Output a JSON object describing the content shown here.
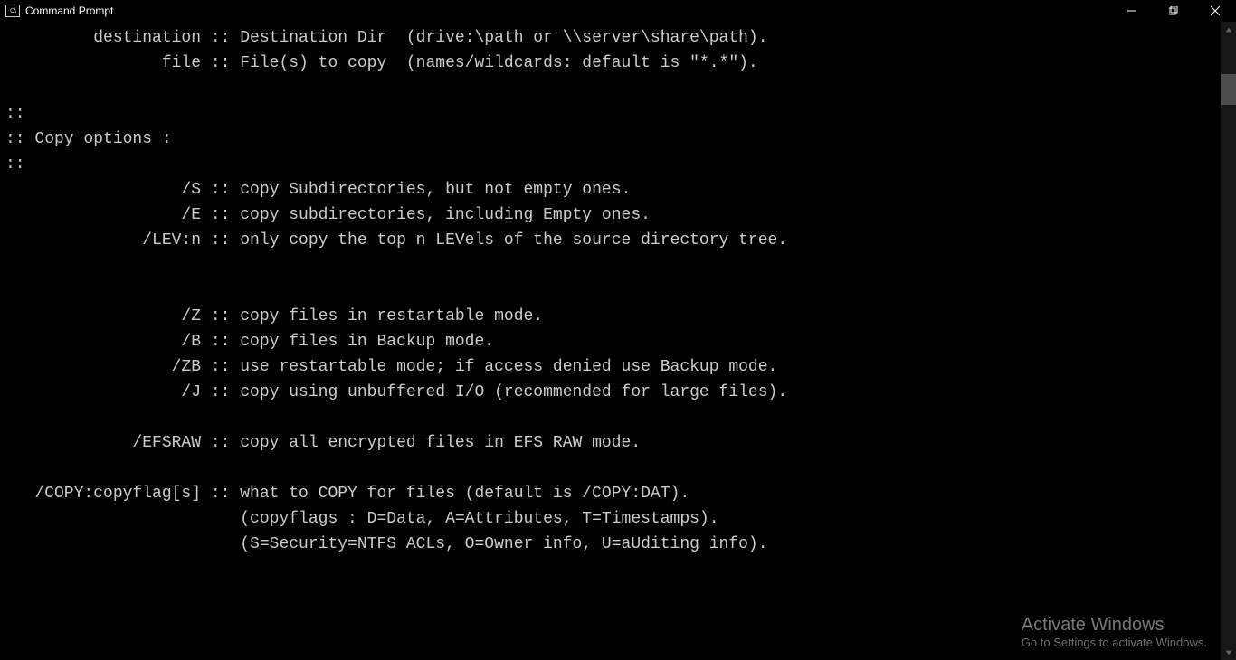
{
  "window": {
    "title": "Command Prompt"
  },
  "terminal_lines": [
    "         destination :: Destination Dir  (drive:\\path or \\\\server\\share\\path).",
    "                file :: File(s) to copy  (names/wildcards: default is \"*.*\").",
    "",
    "::",
    ":: Copy options :",
    "::",
    "                  /S :: copy Subdirectories, but not empty ones.",
    "                  /E :: copy subdirectories, including Empty ones.",
    "              /LEV:n :: only copy the top n LEVels of the source directory tree.",
    "",
    "",
    "                  /Z :: copy files in restartable mode.",
    "                  /B :: copy files in Backup mode.",
    "                 /ZB :: use restartable mode; if access denied use Backup mode.",
    "                  /J :: copy using unbuffered I/O (recommended for large files).",
    "",
    "             /EFSRAW :: copy all encrypted files in EFS RAW mode.",
    "",
    "   /COPY:copyflag[s] :: what to COPY for files (default is /COPY:DAT).",
    "                        (copyflags : D=Data, A=Attributes, T=Timestamps).",
    "                        (S=Security=NTFS ACLs, O=Owner info, U=aUditing info).",
    ""
  ],
  "watermark": {
    "title": "Activate Windows",
    "subtitle": "Go to Settings to activate Windows."
  }
}
